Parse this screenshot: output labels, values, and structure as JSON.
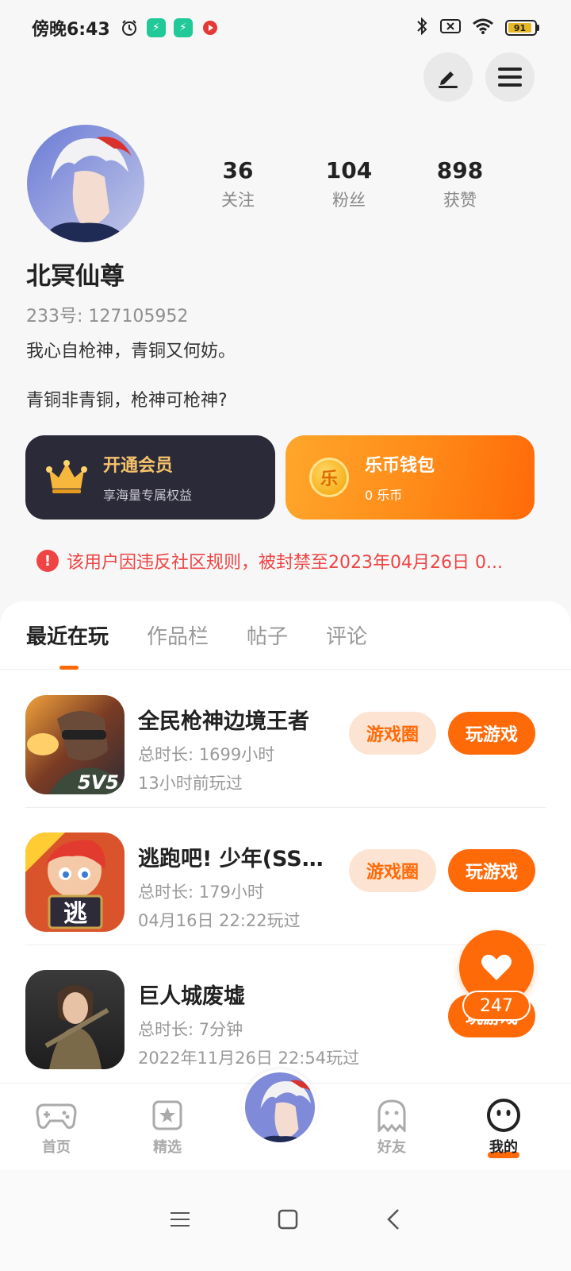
{
  "status_bar": {
    "time": "傍晚6:43",
    "battery": "91"
  },
  "profile": {
    "stats": [
      {
        "value": "36",
        "label": "关注"
      },
      {
        "value": "104",
        "label": "粉丝"
      },
      {
        "value": "898",
        "label": "获赞"
      }
    ],
    "nickname": "北冥仙尊",
    "user_id": "233号: 127105952",
    "bio_line1": "我心自枪神，青铜又何妨。",
    "bio_line2": "青铜非青铜，枪神可枪神?"
  },
  "cards": {
    "vip": {
      "title": "开通会员",
      "subtitle": "享海量专属权益"
    },
    "wallet": {
      "title": "乐币钱包",
      "subtitle": "0 乐币",
      "coin_glyph": "乐"
    }
  },
  "ban_notice": "该用户因违反社区规则，被封禁至2023年04月26日 0...",
  "tabs": [
    "最近在玩",
    "作品栏",
    "帖子",
    "评论"
  ],
  "games": [
    {
      "name": "全民枪神边境王者",
      "total_time": "总时长: 1699小时",
      "last_played": "13小时前玩过",
      "circle_label": "游戏圈",
      "play_label": "玩游戏",
      "badge": "5V5"
    },
    {
      "name": "逃跑吧! 少年(SS1...",
      "total_time": "总时长: 179小时",
      "last_played": "04月16日 22:22玩过",
      "circle_label": "游戏圈",
      "play_label": "玩游戏",
      "badge": "逃"
    },
    {
      "name": "巨人城废墟",
      "total_time": "总时长: 7分钟",
      "last_played": "2022年11月26日 22:54玩过",
      "play_label": "玩游戏"
    }
  ],
  "like": {
    "count": "247"
  },
  "bottom_nav": [
    {
      "label": "首页",
      "icon": "gamepad-icon"
    },
    {
      "label": "精选",
      "icon": "star-bookmark-icon"
    },
    {
      "label": "",
      "icon": "avatar"
    },
    {
      "label": "好友",
      "icon": "ghost-icon"
    },
    {
      "label": "我的",
      "icon": "smiley-icon"
    }
  ],
  "colors": {
    "accent": "#ff6a08",
    "danger": "#ef4444",
    "vip_bg": "#2b2a38",
    "vip_gold": "#f5c26b"
  }
}
